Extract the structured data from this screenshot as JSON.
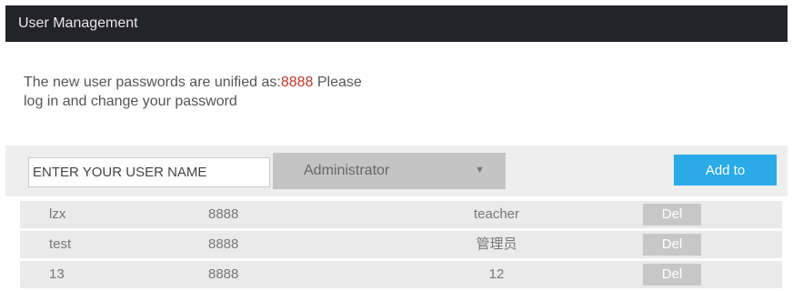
{
  "window": {
    "title": "User Management"
  },
  "notice": {
    "before": "The new user passwords are unified as:",
    "password": "8888",
    "after": " Please log in and change your password"
  },
  "form": {
    "username_placeholder": "ENTER YOUR USER NAME",
    "role_selected": "Administrator",
    "add_label": "Add to"
  },
  "colors": {
    "accent": "#2aabe8",
    "password_highlight": "#c0392b",
    "titlebar": "#23232a"
  },
  "users": [
    {
      "name": "lzx",
      "password": "8888",
      "role": "teacher",
      "delete_label": "Del"
    },
    {
      "name": "test",
      "password": "8888",
      "role": "管理员",
      "delete_label": "Del"
    },
    {
      "name": "13",
      "password": "8888",
      "role": "12",
      "delete_label": "Del"
    }
  ]
}
